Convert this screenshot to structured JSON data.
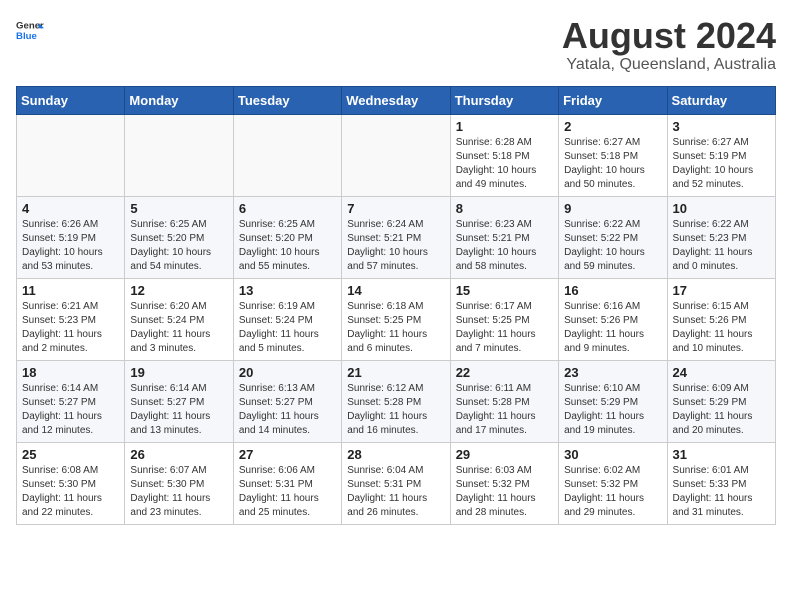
{
  "header": {
    "logo_line1": "General",
    "logo_line2": "Blue",
    "title": "August 2024",
    "subtitle": "Yatala, Queensland, Australia"
  },
  "days_of_week": [
    "Sunday",
    "Monday",
    "Tuesday",
    "Wednesday",
    "Thursday",
    "Friday",
    "Saturday"
  ],
  "weeks": [
    [
      {
        "day": "",
        "empty": true
      },
      {
        "day": "",
        "empty": true
      },
      {
        "day": "",
        "empty": true
      },
      {
        "day": "",
        "empty": true
      },
      {
        "day": "1",
        "sunrise": "6:28 AM",
        "sunset": "5:18 PM",
        "daylight": "10 hours and 49 minutes."
      },
      {
        "day": "2",
        "sunrise": "6:27 AM",
        "sunset": "5:18 PM",
        "daylight": "10 hours and 50 minutes."
      },
      {
        "day": "3",
        "sunrise": "6:27 AM",
        "sunset": "5:19 PM",
        "daylight": "10 hours and 52 minutes."
      }
    ],
    [
      {
        "day": "4",
        "sunrise": "6:26 AM",
        "sunset": "5:19 PM",
        "daylight": "10 hours and 53 minutes."
      },
      {
        "day": "5",
        "sunrise": "6:25 AM",
        "sunset": "5:20 PM",
        "daylight": "10 hours and 54 minutes."
      },
      {
        "day": "6",
        "sunrise": "6:25 AM",
        "sunset": "5:20 PM",
        "daylight": "10 hours and 55 minutes."
      },
      {
        "day": "7",
        "sunrise": "6:24 AM",
        "sunset": "5:21 PM",
        "daylight": "10 hours and 57 minutes."
      },
      {
        "day": "8",
        "sunrise": "6:23 AM",
        "sunset": "5:21 PM",
        "daylight": "10 hours and 58 minutes."
      },
      {
        "day": "9",
        "sunrise": "6:22 AM",
        "sunset": "5:22 PM",
        "daylight": "10 hours and 59 minutes."
      },
      {
        "day": "10",
        "sunrise": "6:22 AM",
        "sunset": "5:23 PM",
        "daylight": "11 hours and 0 minutes."
      }
    ],
    [
      {
        "day": "11",
        "sunrise": "6:21 AM",
        "sunset": "5:23 PM",
        "daylight": "11 hours and 2 minutes."
      },
      {
        "day": "12",
        "sunrise": "6:20 AM",
        "sunset": "5:24 PM",
        "daylight": "11 hours and 3 minutes."
      },
      {
        "day": "13",
        "sunrise": "6:19 AM",
        "sunset": "5:24 PM",
        "daylight": "11 hours and 5 minutes."
      },
      {
        "day": "14",
        "sunrise": "6:18 AM",
        "sunset": "5:25 PM",
        "daylight": "11 hours and 6 minutes."
      },
      {
        "day": "15",
        "sunrise": "6:17 AM",
        "sunset": "5:25 PM",
        "daylight": "11 hours and 7 minutes."
      },
      {
        "day": "16",
        "sunrise": "6:16 AM",
        "sunset": "5:26 PM",
        "daylight": "11 hours and 9 minutes."
      },
      {
        "day": "17",
        "sunrise": "6:15 AM",
        "sunset": "5:26 PM",
        "daylight": "11 hours and 10 minutes."
      }
    ],
    [
      {
        "day": "18",
        "sunrise": "6:14 AM",
        "sunset": "5:27 PM",
        "daylight": "11 hours and 12 minutes."
      },
      {
        "day": "19",
        "sunrise": "6:14 AM",
        "sunset": "5:27 PM",
        "daylight": "11 hours and 13 minutes."
      },
      {
        "day": "20",
        "sunrise": "6:13 AM",
        "sunset": "5:27 PM",
        "daylight": "11 hours and 14 minutes."
      },
      {
        "day": "21",
        "sunrise": "6:12 AM",
        "sunset": "5:28 PM",
        "daylight": "11 hours and 16 minutes."
      },
      {
        "day": "22",
        "sunrise": "6:11 AM",
        "sunset": "5:28 PM",
        "daylight": "11 hours and 17 minutes."
      },
      {
        "day": "23",
        "sunrise": "6:10 AM",
        "sunset": "5:29 PM",
        "daylight": "11 hours and 19 minutes."
      },
      {
        "day": "24",
        "sunrise": "6:09 AM",
        "sunset": "5:29 PM",
        "daylight": "11 hours and 20 minutes."
      }
    ],
    [
      {
        "day": "25",
        "sunrise": "6:08 AM",
        "sunset": "5:30 PM",
        "daylight": "11 hours and 22 minutes."
      },
      {
        "day": "26",
        "sunrise": "6:07 AM",
        "sunset": "5:30 PM",
        "daylight": "11 hours and 23 minutes."
      },
      {
        "day": "27",
        "sunrise": "6:06 AM",
        "sunset": "5:31 PM",
        "daylight": "11 hours and 25 minutes."
      },
      {
        "day": "28",
        "sunrise": "6:04 AM",
        "sunset": "5:31 PM",
        "daylight": "11 hours and 26 minutes."
      },
      {
        "day": "29",
        "sunrise": "6:03 AM",
        "sunset": "5:32 PM",
        "daylight": "11 hours and 28 minutes."
      },
      {
        "day": "30",
        "sunrise": "6:02 AM",
        "sunset": "5:32 PM",
        "daylight": "11 hours and 29 minutes."
      },
      {
        "day": "31",
        "sunrise": "6:01 AM",
        "sunset": "5:33 PM",
        "daylight": "11 hours and 31 minutes."
      }
    ]
  ]
}
